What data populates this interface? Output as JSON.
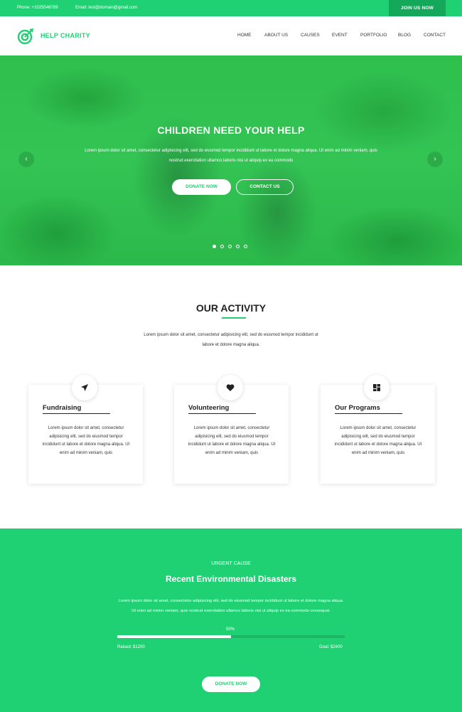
{
  "topbar": {
    "phone": "Phone: +1025546789",
    "email": "Email: test@domain@gmail.com",
    "join_label": "JOIN US NOW"
  },
  "brand": {
    "name": "HELP CHARITY",
    "accent": "#1fd173",
    "logo_icon": "target-icon"
  },
  "nav": {
    "items": [
      "HOME",
      "ABOUT US",
      "CAUSES",
      "EVENT",
      "PORTFOLIO",
      "BLOG",
      "CONTACT"
    ]
  },
  "hero": {
    "title": "CHILDREN NEED YOUR HELP",
    "text": "Lorem ipsum dolor sit amet, consectetur adipisicing elit, sed do eiusmod tempor incididunt ut labore et dolore magna aliqua. Ut enim ad minim veniam, quis nostrud exercitation ullamco laboris nisi ut aliquip ex ea commodo",
    "donate_label": "DONATE NOW",
    "contact_label": "CONTACT US",
    "prev_icon": "chevron-left-icon",
    "next_icon": "chevron-right-icon",
    "slide_count": 5,
    "active_slide": 1
  },
  "activity": {
    "title": "OUR ACTIVITY",
    "text": "Lorem ipsum dolor sit amet, consectetur adipisicing elit, sed do eiusmod tempor incididunt ut labore et dolore magna aliqua.",
    "cards": [
      {
        "icon": "paper-plane-icon",
        "title": "Fundraising",
        "text": "Lorem ipsum dolor sit amet, consectetur adipisicing elit, sed do eiusmod tempor incididunt ut labore et dolore magna aliqua. Ut enim ad minim veniam, quis"
      },
      {
        "icon": "heart-icon",
        "title": "Volunteering",
        "text": "Lorem ipsum dolor sit amet, consectetur adipisicing elit, sed do eiusmod tempor incididunt ut labore et dolore magna aliqua. Ut enim ad minim veniam, quis"
      },
      {
        "icon": "dashboard-grid-icon",
        "title": "Our Programs",
        "text": "Lorem ipsum dolor sit amet, consectetur adipisicing elit, sed do eiusmod tempor incididunt ut labore et dolore magna aliqua. Ut enim ad minim veniam, quis"
      }
    ]
  },
  "urgent": {
    "kicker": "URGENT CAUSE",
    "title": "Recent Environmental Disasters",
    "text": "Lorem ipsum dolor sit amet, consectetur adipisicing elit, sed do eiusmod tempor incididunt ut labore et dolore magna aliqua. Ut enim ad minim veniam, quis nostrud exercitation ullamco laboris nisi ut aliquip ex ea commodo consequat.",
    "progress_label": "50%",
    "progress_fraction": 0.5,
    "raised": "Raised: $1200",
    "goal": "Goal: $2400",
    "donate_label": "DONATE NOW"
  }
}
